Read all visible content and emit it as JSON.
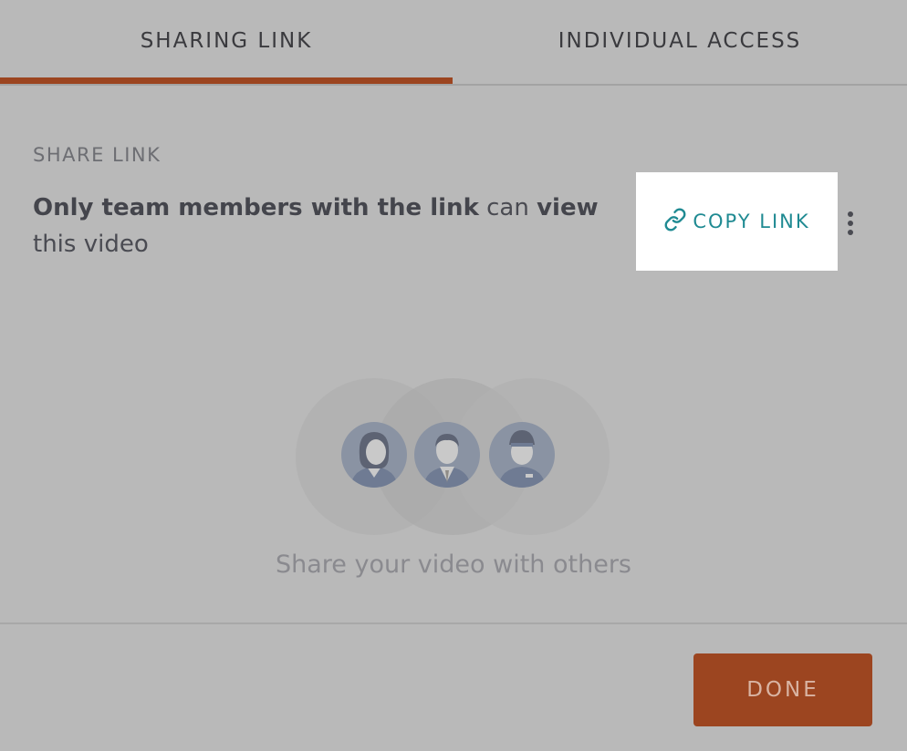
{
  "tabs": [
    {
      "label": "SHARING LINK",
      "active": true
    },
    {
      "label": "INDIVIDUAL ACCESS",
      "active": false
    }
  ],
  "share": {
    "section_label": "SHARE LINK",
    "description": {
      "part1": "Only team members with the link",
      "part2": " can ",
      "part3": "view",
      "part4": " this video"
    },
    "copy_link_label": "COPY LINK",
    "more_icon": "vertical-ellipsis-icon",
    "link_icon": "link-icon"
  },
  "empty_state": {
    "caption": "Share your video with others",
    "avatars": [
      "woman-avatar",
      "man-avatar",
      "cap-man-avatar"
    ]
  },
  "footer": {
    "done_label": "DONE"
  },
  "colors": {
    "accent": "#9c4520",
    "link": "#1f8a92",
    "overlay_bg": "#b9b9b9"
  }
}
